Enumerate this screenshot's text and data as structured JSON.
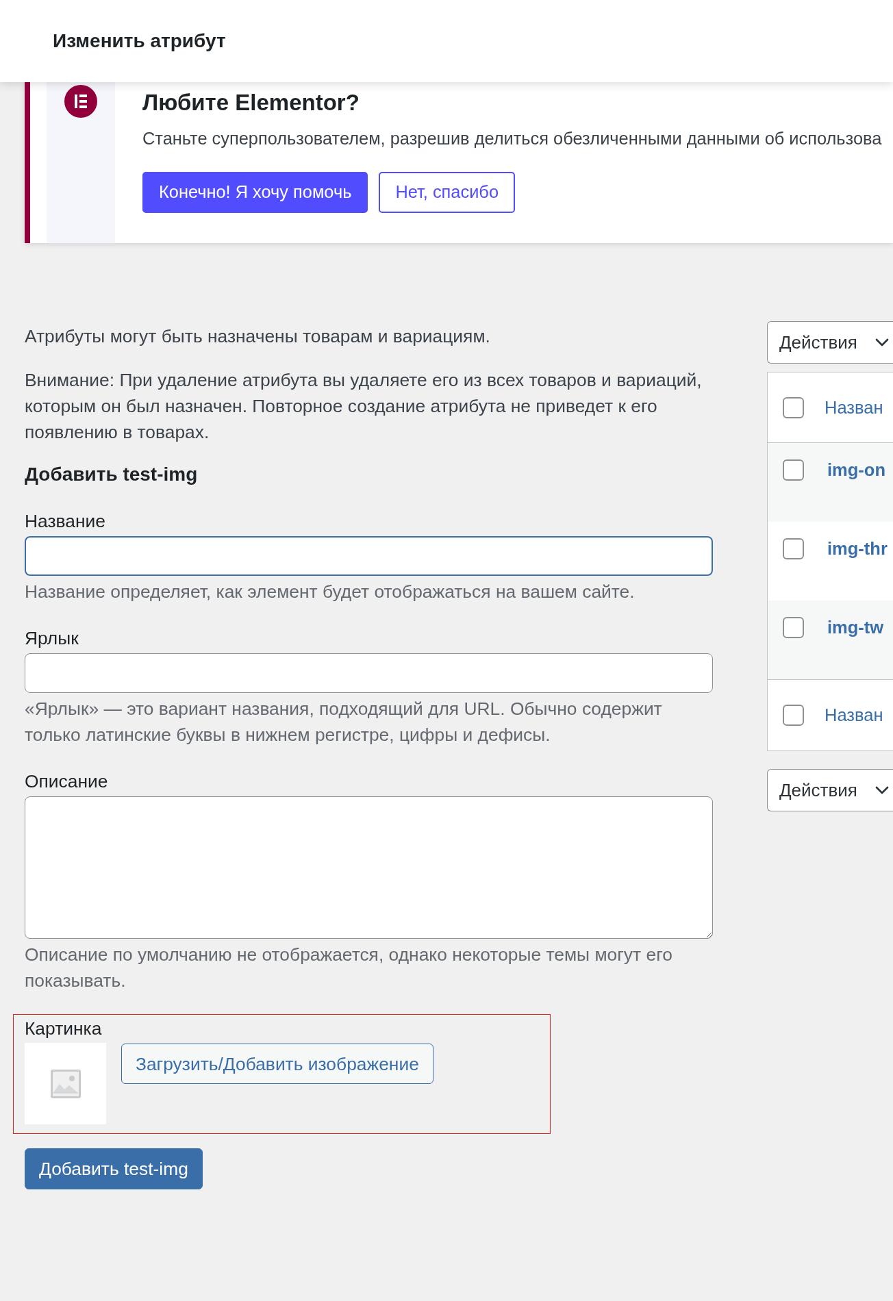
{
  "header": {
    "title": "Изменить атрибут"
  },
  "notice": {
    "title": "Любите Elementor?",
    "message": "Станьте суперпользователем, разрешив делиться обезличенными данными об использова",
    "buttons": [
      {
        "label": "Конечно! Я хочу помочь",
        "kind": "accept"
      },
      {
        "label": "Нет, спасибо",
        "kind": "decline"
      }
    ]
  },
  "form": {
    "intro": "Атрибуты могут быть назначены товарам и вариациям.",
    "warning": "Внимание: При удаление атрибута вы удаляете его из всех товаров и вариаций, которым он был назначен. Повторное создание атрибута не приведет к его появлению в товарах.",
    "heading": "Добавить test-img",
    "fields": [
      {
        "kind": "input",
        "label": "Название",
        "focused": true,
        "description": "Название определяет, как элемент будет отображаться на вашем сайте."
      },
      {
        "kind": "input",
        "label": "Ярлык",
        "focused": false,
        "description": "«Ярлык» — это вариант названия, подходящий для URL. Обычно содержит только латинские буквы в нижнем регистре, цифры и дефисы."
      },
      {
        "kind": "textarea",
        "label": "Описание",
        "description": "Описание по умолчанию не отображается, однако некоторые темы могут его показывать."
      },
      {
        "kind": "image",
        "label": "Картинка",
        "button": "Загрузить/Добавить изображение",
        "highlighted": true
      }
    ],
    "submit": "Добавить test-img"
  },
  "table": {
    "bulk_actions_top": "Действия",
    "header": {
      "label": "Назван",
      "checked": false
    },
    "rows": [
      {
        "name": "img-on",
        "checked": false
      },
      {
        "name": "img-thr",
        "checked": false
      },
      {
        "name": "img-tw",
        "checked": false
      }
    ],
    "footer": {
      "label": "Назван",
      "checked": false
    },
    "bulk_actions_bottom": "Действия"
  }
}
